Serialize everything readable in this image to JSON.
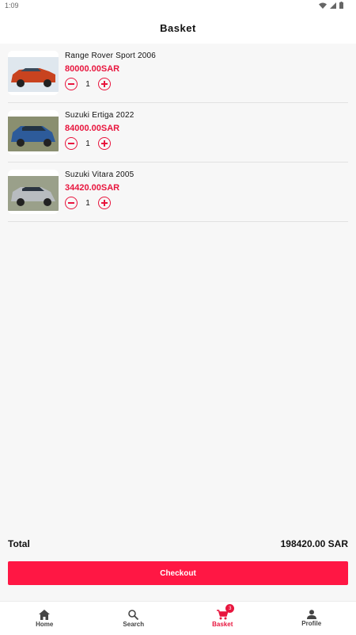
{
  "status": {
    "time": "1:09"
  },
  "header": {
    "title": "Basket"
  },
  "basket": {
    "items": [
      {
        "name": "Range Rover Sport 2006",
        "price": "80000.00SAR",
        "quantity": "1",
        "car_color": "#c8431f"
      },
      {
        "name": "Suzuki Ertiga 2022",
        "price": "84000.00SAR",
        "quantity": "1",
        "car_color": "#2d5b9a"
      },
      {
        "name": "Suzuki Vitara 2005",
        "price": "34420.00SAR",
        "quantity": "1",
        "car_color": "#b8bcc0"
      }
    ]
  },
  "summary": {
    "total_label": "Total",
    "total_value": "198420.00 SAR"
  },
  "checkout": {
    "label": "Checkout"
  },
  "nav": {
    "home": "Home",
    "search": "Search",
    "basket": "Basket",
    "basket_badge": "3",
    "profile": "Profile"
  },
  "colors": {
    "accent": "#ff1744",
    "price": "#e8163e"
  }
}
